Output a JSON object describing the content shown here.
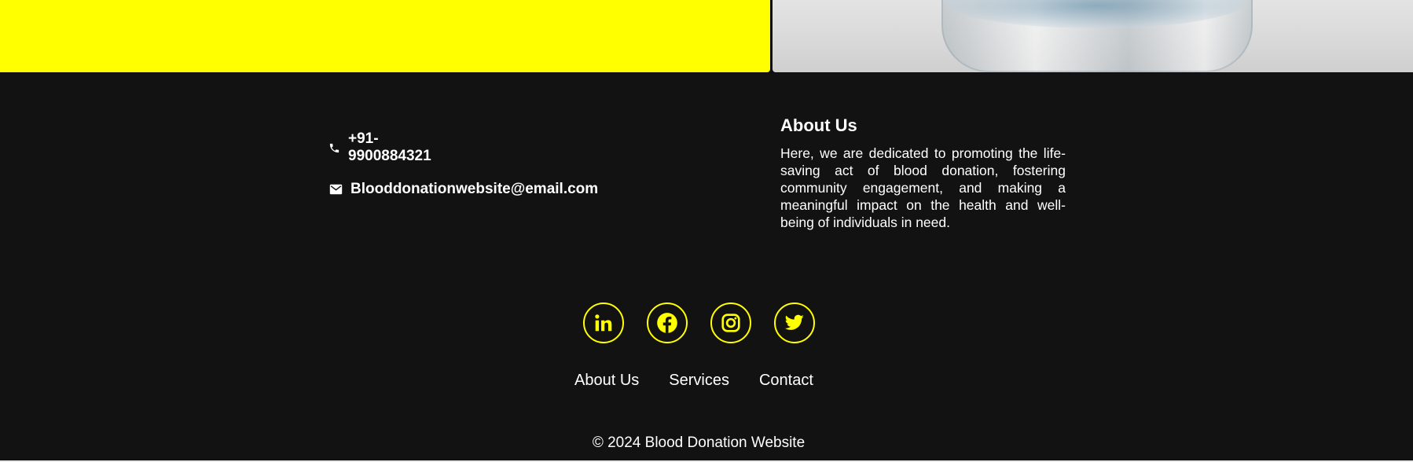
{
  "contact": {
    "phone": "+91-9900884321",
    "email": "Blooddonationwebsite@email.com",
    "phone_icon": "phone-icon",
    "email_icon": "mail-icon"
  },
  "about": {
    "title": "About Us",
    "text": "Here, we are dedicated to promoting the life-saving act of blood donation, fostering community engagement, and making a meaningful impact on the health and well-being of individuals in need."
  },
  "socials": [
    "linkedin-icon",
    "facebook-icon",
    "instagram-icon",
    "twitter-icon"
  ],
  "footer_nav": {
    "about": "About Us",
    "services": "Services",
    "contact": "Contact"
  },
  "copyright": "© 2024 Blood Donation Website",
  "colors": {
    "accent": "#ffff00",
    "background": "#121212",
    "text": "#ffffff"
  }
}
